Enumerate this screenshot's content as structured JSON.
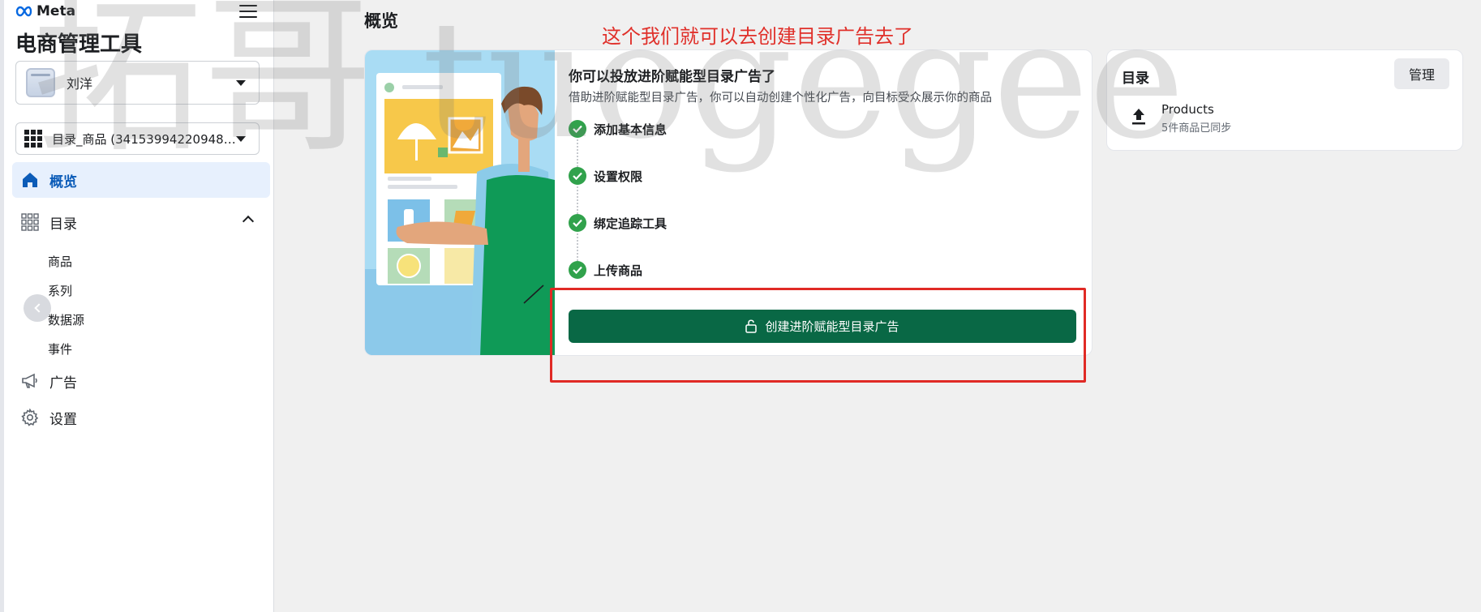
{
  "sidebar": {
    "brand": "Meta",
    "app_title": "电商管理工具",
    "account": {
      "label": "刘洋"
    },
    "catalog": {
      "label": "目录_商品 (34153994220948…"
    },
    "nav": {
      "overview": "概览",
      "catalog": "目录",
      "catalog_sub": [
        "商品",
        "系列",
        "数据源",
        "事件"
      ],
      "ads": "广告",
      "settings": "设置"
    }
  },
  "main": {
    "page_title": "概览",
    "annotation": "这个我们就可以去创建目录广告去了",
    "setup_card": {
      "title": "你可以投放进阶赋能型目录广告了",
      "description": "借助进阶赋能型目录广告，你可以自动创建个性化广告，向目标受众展示你的商品",
      "steps": [
        "添加基本信息",
        "设置权限",
        "绑定追踪工具",
        "上传商品"
      ],
      "button_label": "创建进阶赋能型目录广告"
    },
    "catalog_card": {
      "title": "目录",
      "manage_label": "管理",
      "product_name": "Products",
      "product_sync": "5件商品已同步"
    }
  },
  "watermark": {
    "cjk": "拓哥",
    "latin": "tuogegee"
  },
  "colors": {
    "primary_green": "#096845",
    "check_green": "#31a24c",
    "active_blue": "#0c5cb8",
    "active_bg": "#e7f0fd",
    "annotation_red": "#e0302a"
  }
}
